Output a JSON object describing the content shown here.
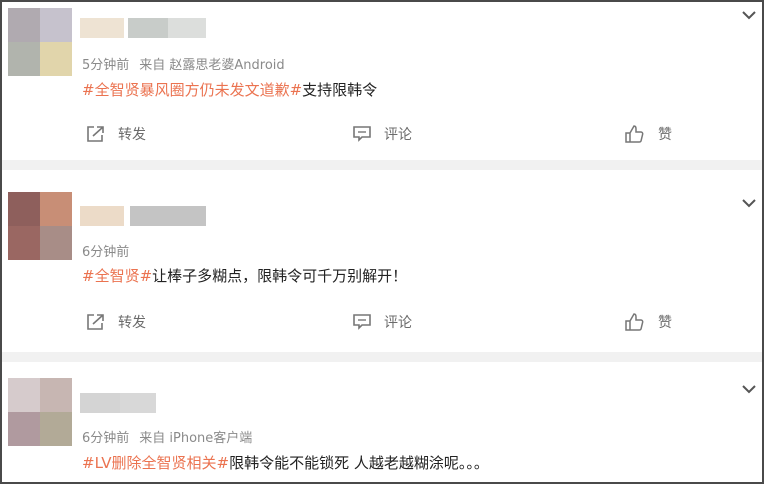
{
  "colors": {
    "accent": "#eb7350",
    "text": "#222222",
    "meta": "#8a8a8a",
    "divider": "#f1f1f1",
    "border": "#4a4a4a"
  },
  "actions": {
    "repost": "转发",
    "comment": "评论",
    "like": "赞"
  },
  "posts": [
    {
      "time": "5分钟前",
      "source": "来自 赵露思老婆Android",
      "hashtag": "#全智贤暴风圈方仍未发文道歉#",
      "text": "支持限韩令",
      "avatar_colors": [
        "#b0aab0",
        "#c6c2cd",
        "#b1b4ad",
        "#e1d5ab"
      ],
      "name_colors": [
        "#eee3d3",
        "#c8ccc9",
        "#dcdedc"
      ]
    },
    {
      "time": "6分钟前",
      "source": "",
      "hashtag": "#全智贤#",
      "text": "让棒子多糊点，限韩令可千万别解开！",
      "avatar_colors": [
        "#8e5f5c",
        "#c88e76",
        "#9a6762",
        "#a88d87"
      ],
      "name_colors": [
        "#ecdbc8",
        "#c4c4c4"
      ]
    },
    {
      "time": "6分钟前",
      "source": "来自 iPhone客户端",
      "hashtag": "#LV删除全智贤相关#",
      "text": "限韩令能不能锁死 人越老越糊涂呢。。。",
      "avatar_colors": [
        "#d6cbcc",
        "#c7b6b2",
        "#b09a9f",
        "#b2aa97"
      ],
      "name_colors": [
        "#d4d4d4",
        "#d8d8d8"
      ]
    }
  ],
  "icons": {
    "repost": "repost-icon",
    "comment": "comment-icon",
    "like": "like-icon",
    "expand": "chevron-down-icon"
  }
}
